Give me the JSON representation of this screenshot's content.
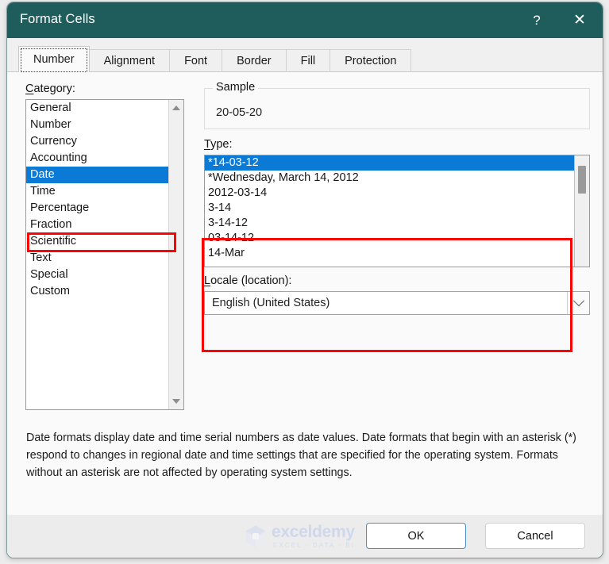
{
  "window": {
    "title": "Format Cells",
    "help_glyph": "?",
    "close_glyph": "✕"
  },
  "tabs": [
    {
      "label": "Number",
      "active": true
    },
    {
      "label": "Alignment",
      "active": false
    },
    {
      "label": "Font",
      "active": false
    },
    {
      "label": "Border",
      "active": false
    },
    {
      "label": "Fill",
      "active": false
    },
    {
      "label": "Protection",
      "active": false
    }
  ],
  "category": {
    "label_prefix": "C",
    "label_rest": "ategory:",
    "items": [
      "General",
      "Number",
      "Currency",
      "Accounting",
      "Date",
      "Time",
      "Percentage",
      "Fraction",
      "Scientific",
      "Text",
      "Special",
      "Custom"
    ],
    "selected": "Date",
    "selected_index": 4
  },
  "sample": {
    "legend": "Sample",
    "value": "20-05-20"
  },
  "type": {
    "label_prefix": "T",
    "label_rest": "ype:",
    "items": [
      "*14-03-12",
      "*Wednesday, March 14, 2012",
      "2012-03-14",
      "3-14",
      "3-14-12",
      "03-14-12",
      "14-Mar"
    ],
    "selected": "*14-03-12",
    "selected_index": 0
  },
  "locale": {
    "label_prefix": "L",
    "label_rest": "ocale (location):",
    "value": "English (United States)"
  },
  "description": "Date formats display date and time serial numbers as date values.  Date formats that begin with an asterisk (*) respond to changes in regional date and time settings that are specified for the operating system. Formats without an asterisk are not affected by operating system settings.",
  "footer": {
    "ok_label": "OK",
    "cancel_label": "Cancel"
  },
  "watermark": {
    "name": "exceldemy",
    "tagline": "EXCEL · DATA · BI"
  },
  "colors": {
    "titlebar": "#1f5c5c",
    "selection": "#0a7ad6",
    "annotation": "#fb0404",
    "panel": "#fafafa",
    "footer": "#ececed"
  }
}
